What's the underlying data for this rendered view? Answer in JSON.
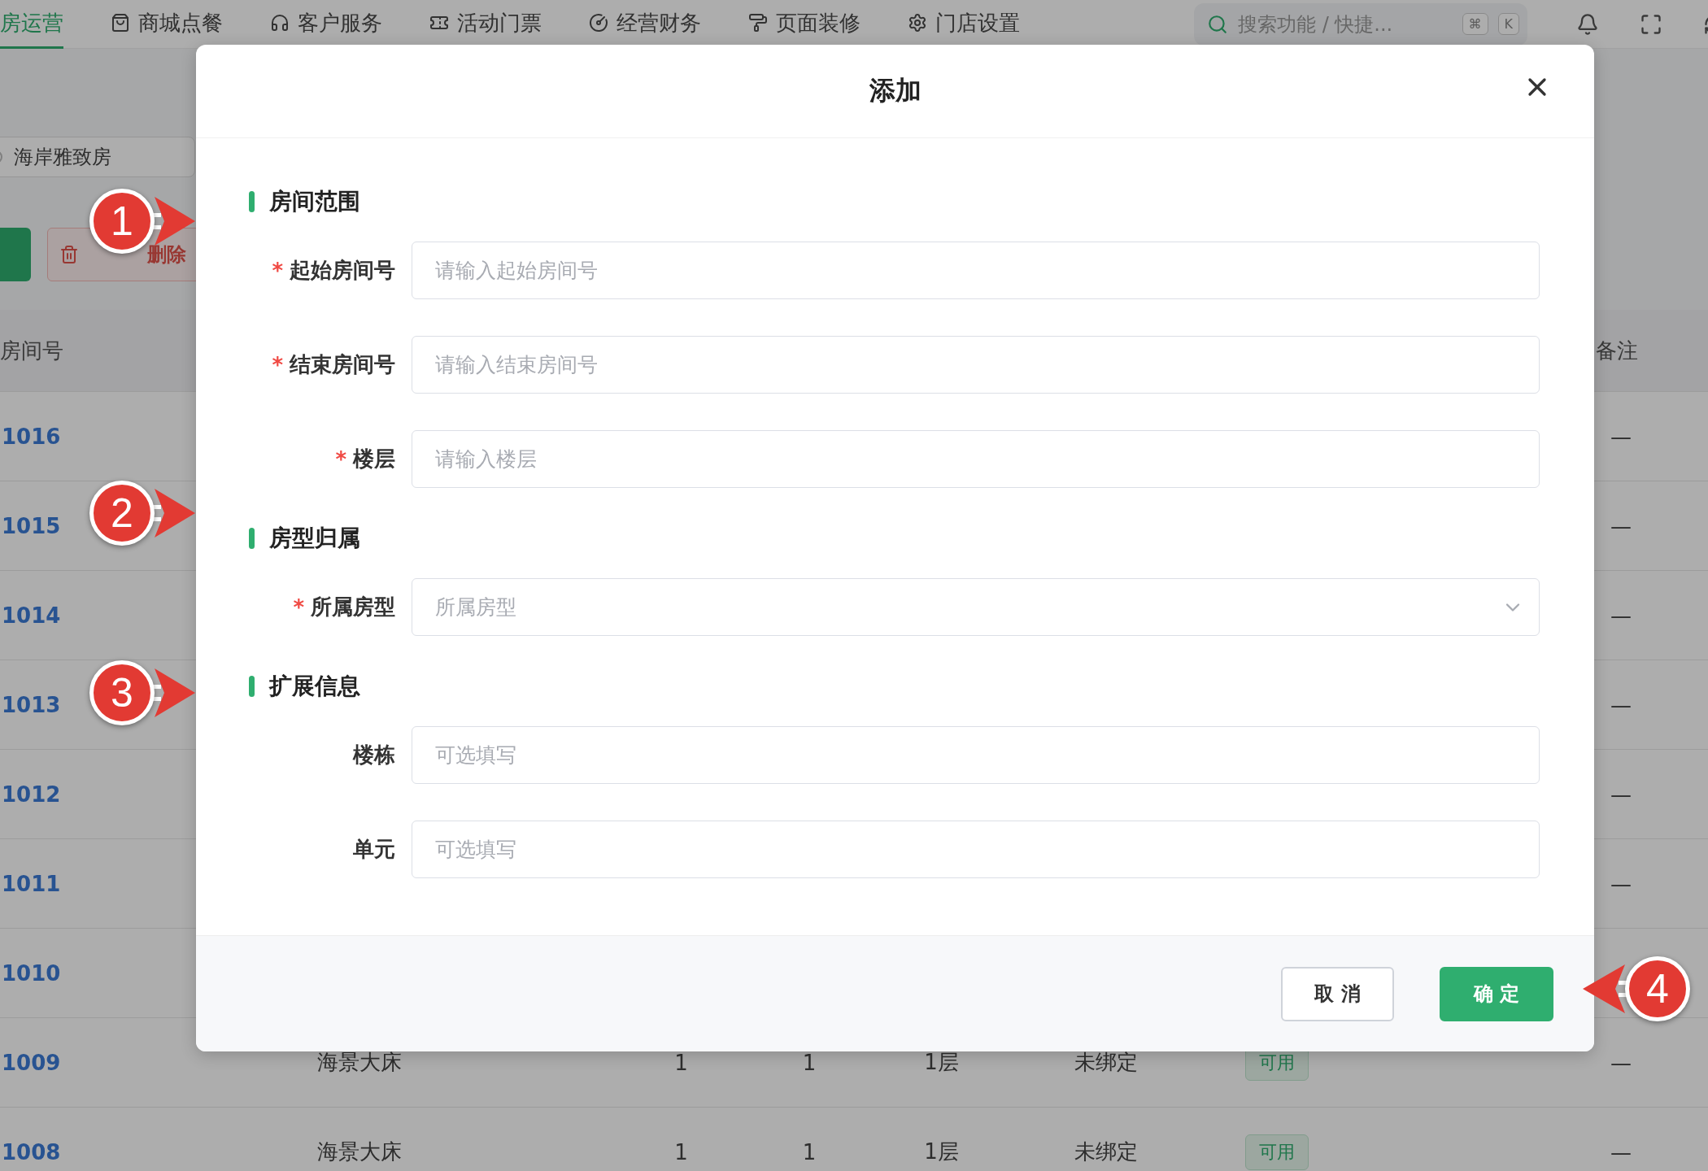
{
  "nav": {
    "tabs": [
      {
        "label": "房运营",
        "selected": true
      },
      {
        "label": "商城点餐",
        "selected": false
      },
      {
        "label": "客户服务",
        "selected": false
      },
      {
        "label": "活动门票",
        "selected": false
      },
      {
        "label": "经营财务",
        "selected": false
      },
      {
        "label": "页面装修",
        "selected": false
      },
      {
        "label": "门店设置",
        "selected": false
      }
    ],
    "search": {
      "placeholder": "搜索功能 / 快捷...",
      "keys": [
        "⌘",
        "K"
      ]
    }
  },
  "filter_chip": "海岸雅致房",
  "actions": {
    "delete_label": "删除"
  },
  "table": {
    "columns": {
      "room": "房间号",
      "remark": "备注"
    },
    "rows": [
      {
        "room": "1016",
        "remark": "—"
      },
      {
        "room": "1015",
        "remark": "—"
      },
      {
        "room": "1014",
        "remark": "—"
      },
      {
        "room": "1013",
        "remark": "—"
      },
      {
        "room": "1012",
        "remark": "—"
      },
      {
        "room": "1011",
        "remark": "—"
      },
      {
        "room": "1010"
      },
      {
        "room": "1009",
        "type": "海景大床",
        "column_3": "1",
        "column_4": "1",
        "floor": "1层",
        "binding": "未绑定",
        "status": "可用",
        "remark": "—"
      },
      {
        "room": "1008",
        "type": "海景大床",
        "column_3": "1",
        "column_4": "1",
        "floor": "1层",
        "binding": "未绑定",
        "status": "可用",
        "remark": "—"
      }
    ]
  },
  "dialog": {
    "title": "添加",
    "sections": [
      {
        "title": "房间范围",
        "fields": [
          {
            "label": "起始房间号",
            "required_mark": "*",
            "kind": "input",
            "placeholder": "请输入起始房间号"
          },
          {
            "label": "结束房间号",
            "required_mark": "*",
            "kind": "input",
            "placeholder": "请输入结束房间号"
          },
          {
            "label": "楼层",
            "required_mark": "*",
            "kind": "input",
            "placeholder": "请输入楼层"
          }
        ]
      },
      {
        "title": "房型归属",
        "fields": [
          {
            "label": "所属房型",
            "required_mark": "*",
            "kind": "select",
            "placeholder": "所属房型"
          }
        ]
      },
      {
        "title": "扩展信息",
        "fields": [
          {
            "label": "楼栋",
            "kind": "input",
            "placeholder": "可选填写"
          },
          {
            "label": "单元",
            "kind": "input",
            "placeholder": "可选填写"
          }
        ]
      }
    ],
    "buttons": [
      {
        "label": "取 消",
        "kind": "secondary"
      },
      {
        "label": "确 定",
        "kind": "primary"
      }
    ]
  },
  "annotations": [
    {
      "label": "1",
      "kind": "right"
    },
    {
      "label": "2",
      "kind": "right"
    },
    {
      "label": "3",
      "kind": "right"
    },
    {
      "label": "4",
      "kind": "left"
    }
  ]
}
